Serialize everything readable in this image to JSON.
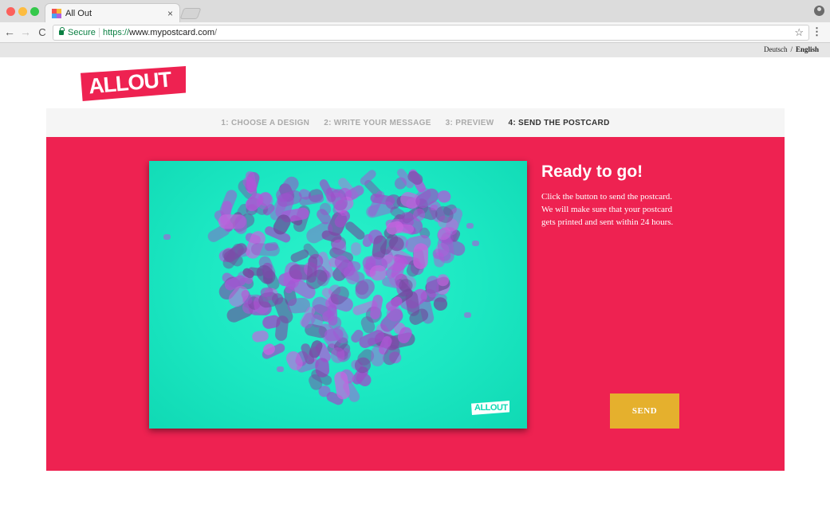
{
  "browser": {
    "tab_title": "All Out",
    "tab_close": "×",
    "secure_label": "Secure",
    "url_scheme": "https://",
    "url_host": "www.mypostcard.com",
    "url_path": "/",
    "back_glyph": "←",
    "forward_glyph": "→",
    "reload_glyph": "C",
    "star_glyph": "☆",
    "menu_glyph": "⋮"
  },
  "language": {
    "deutsch": "Deutsch",
    "separator": "/",
    "english": "English",
    "active": "English"
  },
  "brand": {
    "logo_text": "ALLOUT",
    "card_logo_text": "ALLOUT",
    "color_primary": "#ee2251",
    "color_card": "#1be7c2",
    "color_button": "#e5b02d"
  },
  "steps": [
    {
      "label": "1: CHOOSE A DESIGN",
      "active": false
    },
    {
      "label": "2: WRITE YOUR MESSAGE",
      "active": false
    },
    {
      "label": "3: PREVIEW",
      "active": false
    },
    {
      "label": "4: SEND THE POSTCARD",
      "active": true
    }
  ],
  "main": {
    "title": "Ready to go!",
    "description": "Click the button to send the postcard. We will make sure that your postcard gets printed and sent within 24 hours.",
    "send_label": "SEND"
  }
}
